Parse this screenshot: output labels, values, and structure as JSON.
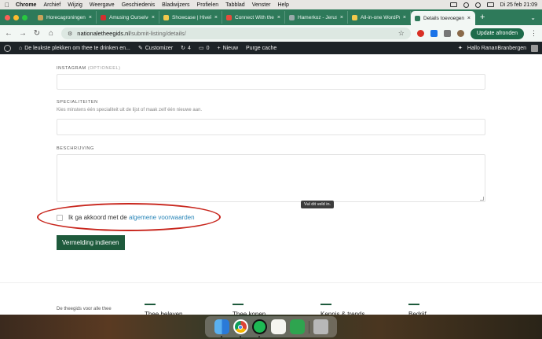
{
  "menubar": {
    "items": [
      "Chrome",
      "Archief",
      "Wijzig",
      "Weergave",
      "Geschiedenis",
      "Bladwijzers",
      "Profielen",
      "Tabblad",
      "Venster",
      "Help"
    ],
    "datetime": "Di 25 feb  21:09"
  },
  "tabs": [
    {
      "title": "Horecagroningen",
      "favicon_color": "#c9a35b"
    },
    {
      "title": "Amusing Ourselve",
      "favicon_color": "#d32f2f"
    },
    {
      "title": "Showcase | HiveP",
      "favicon_color": "#f2c94c"
    },
    {
      "title": "Connect With the",
      "favicon_color": "#e74c3c"
    },
    {
      "title": "Hamerkoz - Jerus",
      "favicon_color": "#9aa"
    },
    {
      "title": "All-in-one WordPr",
      "favicon_color": "#f2c94c"
    },
    {
      "title": "Details toevoegen",
      "favicon_color": "#2e7a5a",
      "active": true
    }
  ],
  "address": {
    "host": "nationaletheegids.nl",
    "path": "/submit-listing/details/",
    "update_label": "Update afronden"
  },
  "wpbar": {
    "site": "De leukste plekken om thee te drinken en...",
    "customize": "Customizer",
    "updates": "4",
    "comments": "0",
    "new": "Nieuw",
    "purge": "Purge cache",
    "greeting": "Hallo RananBranbergen"
  },
  "form": {
    "instagram_label": "INSTAGRAM",
    "instagram_optional": "(OPTIONEEL)",
    "specialiteiten_label": "SPECIALITEITEN",
    "specialiteiten_hint": "Kies minstens één specialiteit uit de lijst of maak zelf één nieuwe aan.",
    "beschrijving_label": "BESCHRIJVING",
    "tooltip": "Vul dit veld in.",
    "terms_prefix": "Ik ga akkoord met de",
    "terms_link": "algemene voorwaarden",
    "submit_label": "Vermelding indienen"
  },
  "footer": {
    "tagline": "De theegids voor alle thee",
    "columns": [
      "Thee beleven",
      "Thee kopen",
      "Kennis & trends",
      "Bedrijf"
    ]
  },
  "colors": {
    "brand_green": "#1e5a3c",
    "annotation_red": "#c8261d",
    "link_blue": "#2a86b8"
  }
}
